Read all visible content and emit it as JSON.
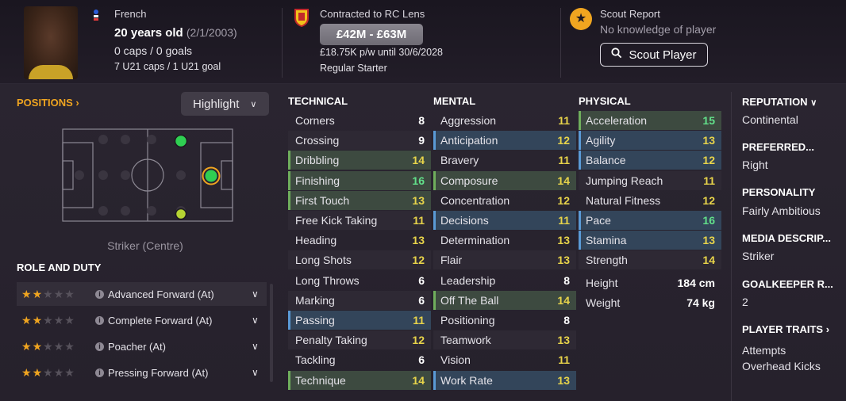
{
  "header": {
    "nationality": "French",
    "age": "20 years old",
    "dob": "(2/1/2003)",
    "caps_goals": "0 caps / 0 goals",
    "u21": "7 U21 caps / 1 U21 goal",
    "contract": "Contracted to RC Lens",
    "value_range": "£42M - £63M",
    "wage": "£18.75K p/w until 30/6/2028",
    "squad_status": "Regular Starter",
    "scout_title": "Scout Report",
    "scout_text": "No knowledge of player",
    "scout_button": "Scout Player",
    "icons": {
      "flag": "france-flag-icon",
      "crest": "rc-lens-crest-icon",
      "scout": "star-icon",
      "search": "search-icon"
    }
  },
  "positions": {
    "title": "POSITIONS",
    "highlight_label": "Highlight",
    "position_label": "Striker (Centre)"
  },
  "role": {
    "title": "ROLE AND DUTY",
    "items": [
      {
        "name": "Advanced Forward (At)",
        "stars": 2
      },
      {
        "name": "Complete Forward (At)",
        "stars": 2
      },
      {
        "name": "Poacher (At)",
        "stars": 2
      },
      {
        "name": "Pressing Forward (At)",
        "stars": 2
      }
    ]
  },
  "technical": {
    "title": "TECHNICAL",
    "rows": [
      {
        "name": "Corners",
        "value": "8",
        "hl": ""
      },
      {
        "name": "Crossing",
        "value": "9",
        "hl": ""
      },
      {
        "name": "Dribbling",
        "value": "14",
        "hl": "g"
      },
      {
        "name": "Finishing",
        "value": "16",
        "hl": "g"
      },
      {
        "name": "First Touch",
        "value": "13",
        "hl": "g"
      },
      {
        "name": "Free Kick Taking",
        "value": "11",
        "hl": ""
      },
      {
        "name": "Heading",
        "value": "13",
        "hl": ""
      },
      {
        "name": "Long Shots",
        "value": "12",
        "hl": ""
      },
      {
        "name": "Long Throws",
        "value": "6",
        "hl": ""
      },
      {
        "name": "Marking",
        "value": "6",
        "hl": ""
      },
      {
        "name": "Passing",
        "value": "11",
        "hl": "b"
      },
      {
        "name": "Penalty Taking",
        "value": "12",
        "hl": ""
      },
      {
        "name": "Tackling",
        "value": "6",
        "hl": ""
      },
      {
        "name": "Technique",
        "value": "14",
        "hl": "g"
      }
    ]
  },
  "mental": {
    "title": "MENTAL",
    "rows": [
      {
        "name": "Aggression",
        "value": "11",
        "hl": ""
      },
      {
        "name": "Anticipation",
        "value": "12",
        "hl": "b"
      },
      {
        "name": "Bravery",
        "value": "11",
        "hl": ""
      },
      {
        "name": "Composure",
        "value": "14",
        "hl": "g"
      },
      {
        "name": "Concentration",
        "value": "12",
        "hl": ""
      },
      {
        "name": "Decisions",
        "value": "11",
        "hl": "b"
      },
      {
        "name": "Determination",
        "value": "13",
        "hl": ""
      },
      {
        "name": "Flair",
        "value": "13",
        "hl": ""
      },
      {
        "name": "Leadership",
        "value": "8",
        "hl": ""
      },
      {
        "name": "Off The Ball",
        "value": "14",
        "hl": "g"
      },
      {
        "name": "Positioning",
        "value": "8",
        "hl": ""
      },
      {
        "name": "Teamwork",
        "value": "13",
        "hl": ""
      },
      {
        "name": "Vision",
        "value": "11",
        "hl": ""
      },
      {
        "name": "Work Rate",
        "value": "13",
        "hl": "b"
      }
    ]
  },
  "physical": {
    "title": "PHYSICAL",
    "rows": [
      {
        "name": "Acceleration",
        "value": "15",
        "hl": "g"
      },
      {
        "name": "Agility",
        "value": "13",
        "hl": "b"
      },
      {
        "name": "Balance",
        "value": "12",
        "hl": "b"
      },
      {
        "name": "Jumping Reach",
        "value": "11",
        "hl": ""
      },
      {
        "name": "Natural Fitness",
        "value": "12",
        "hl": ""
      },
      {
        "name": "Pace",
        "value": "16",
        "hl": "b"
      },
      {
        "name": "Stamina",
        "value": "13",
        "hl": "b"
      },
      {
        "name": "Strength",
        "value": "14",
        "hl": ""
      }
    ],
    "height_label": "Height",
    "height": "184 cm",
    "weight_label": "Weight",
    "weight": "74 kg"
  },
  "side": {
    "reputation_label": "REPUTATION",
    "reputation": "Continental",
    "foot_label": "PREFERRED...",
    "foot": "Right",
    "personality_label": "PERSONALITY",
    "personality": "Fairly Ambitious",
    "media_label": "MEDIA DESCRIP...",
    "media": "Striker",
    "gk_label": "GOALKEEPER R...",
    "gk": "2",
    "traits_label": "PLAYER TRAITS",
    "traits": [
      "Attempts",
      "Overhead Kicks"
    ]
  },
  "colors": {
    "accent": "#f0a520",
    "good": "#62e08a",
    "high": "#e8d44a",
    "key_green": "#3d4a40",
    "key_blue": "#33455a"
  }
}
